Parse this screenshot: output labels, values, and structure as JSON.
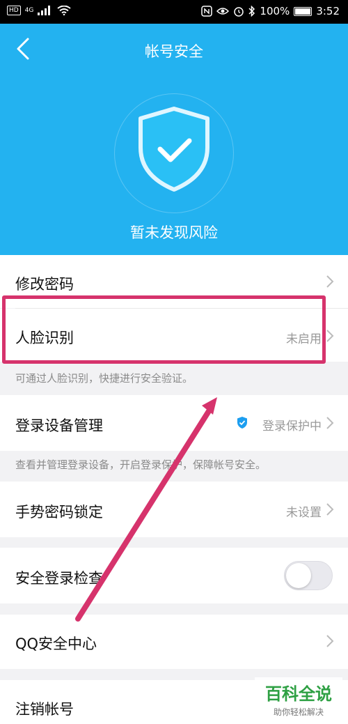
{
  "status_bar": {
    "hd": "HD",
    "network": "4G",
    "battery": "100%",
    "time": "3:52"
  },
  "header": {
    "title": "帐号安全",
    "status": "暂未发现风险"
  },
  "items": {
    "change_password": {
      "label": "修改密码"
    },
    "face_recognition": {
      "label": "人脸识别",
      "value": "未启用",
      "hint": "可通过人脸识别，快捷进行安全验证。"
    },
    "device_management": {
      "label": "登录设备管理",
      "value": "登录保护中",
      "hint": "查看并管理登录设备，开启登录保护，保障帐号安全。"
    },
    "gesture_lock": {
      "label": "手势密码锁定",
      "value": "未设置"
    },
    "safe_login_check": {
      "label": "安全登录检查",
      "enabled": false
    },
    "qq_security_center": {
      "label": "QQ安全中心"
    },
    "deregister": {
      "label": "注销帐号"
    }
  },
  "watermark": {
    "main": "百科全说",
    "sub": "助你轻松解决"
  },
  "colors": {
    "header_bg": "#23b2f0",
    "highlight": "#d6336c",
    "watermark_green": "#2ea043"
  }
}
